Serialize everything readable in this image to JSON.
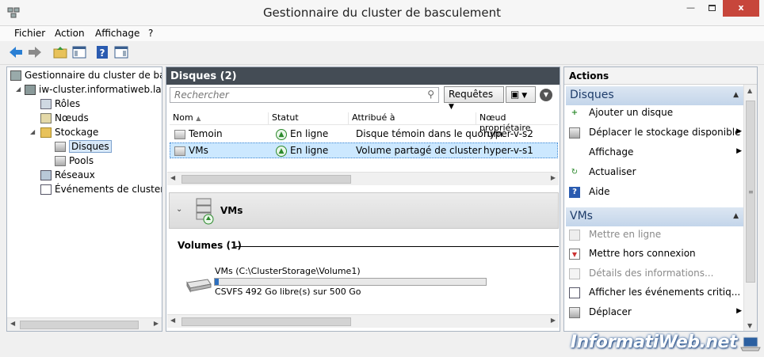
{
  "window": {
    "title": "Gestionnaire du cluster de basculement",
    "close": "x"
  },
  "menu": [
    "Fichier",
    "Action",
    "Affichage",
    "?"
  ],
  "tree": {
    "root": "Gestionnaire du cluster de bascu",
    "cluster": "iw-cluster.informatiweb.lan",
    "roles": "Rôles",
    "nodes": "Nœuds",
    "storage": "Stockage",
    "disks": "Disques",
    "pools": "Pools",
    "networks": "Réseaux",
    "events": "Événements de cluster"
  },
  "center": {
    "header": "Disques (2)",
    "search_placeholder": "Rechercher",
    "queries_button": "Requêtes",
    "columns": [
      "Nom",
      "Statut",
      "Attribué à",
      "Nœud propriétaire"
    ],
    "rows": [
      {
        "name": "Temoin",
        "status": "En ligne",
        "assigned": "Disque témoin dans le quorum",
        "owner": "hyper-v-s2"
      },
      {
        "name": "VMs",
        "status": "En ligne",
        "assigned": "Volume partagé de cluster",
        "owner": "hyper-v-s1"
      }
    ],
    "detail_title": "VMs",
    "volumes_title": "Volumes (1)",
    "volume": {
      "name": "VMs (C:\\ClusterStorage\\Volume1)",
      "info": "CSVFS 492 Go libre(s) sur 500 Go",
      "used_fraction": 0.016
    }
  },
  "actions": {
    "header": "Actions",
    "disks_section": "Disques",
    "disks_items": [
      "Ajouter un disque",
      "Déplacer le stockage disponible",
      "Affichage",
      "Actualiser",
      "Aide"
    ],
    "vms_section": "VMs",
    "vms_items": [
      "Mettre en ligne",
      "Mettre hors connexion",
      "Détails des informations...",
      "Afficher les événements critiq...",
      "Déplacer"
    ]
  },
  "watermark": "InformatiWeb.net"
}
